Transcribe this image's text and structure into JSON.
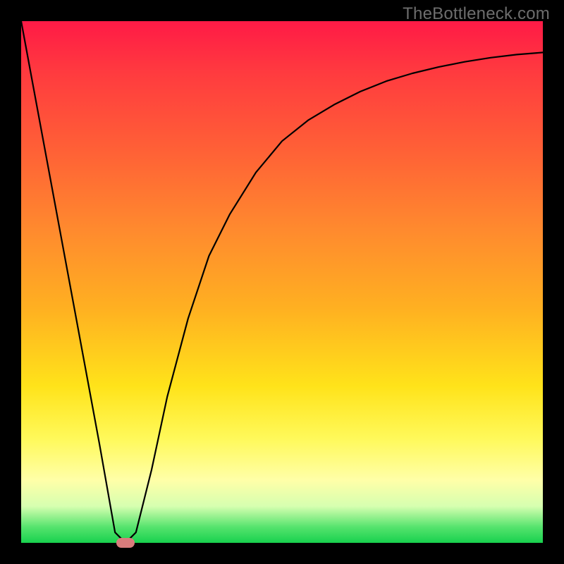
{
  "watermark": "TheBottleneck.com",
  "chart_data": {
    "type": "line",
    "title": "",
    "xlabel": "",
    "ylabel": "",
    "xlim": [
      0,
      100
    ],
    "ylim": [
      0,
      100
    ],
    "series": [
      {
        "name": "bottleneck-curve",
        "x": [
          0,
          5,
          10,
          15,
          18,
          20,
          22,
          25,
          28,
          32,
          36,
          40,
          45,
          50,
          55,
          60,
          65,
          70,
          75,
          80,
          85,
          90,
          95,
          100
        ],
        "y": [
          100,
          73,
          46,
          19,
          2,
          0,
          2,
          14,
          28,
          43,
          55,
          63,
          71,
          77,
          81,
          84,
          86.5,
          88.5,
          90,
          91.2,
          92.2,
          93,
          93.6,
          94
        ]
      }
    ],
    "marker": {
      "x": 20,
      "y": 0,
      "color": "#d97c7c"
    },
    "gradient_stops": [
      {
        "pct": 0,
        "color": "#ff1a46"
      },
      {
        "pct": 25,
        "color": "#ff6136"
      },
      {
        "pct": 55,
        "color": "#ffb021"
      },
      {
        "pct": 80,
        "color": "#fff95a"
      },
      {
        "pct": 100,
        "color": "#18d14e"
      }
    ]
  }
}
